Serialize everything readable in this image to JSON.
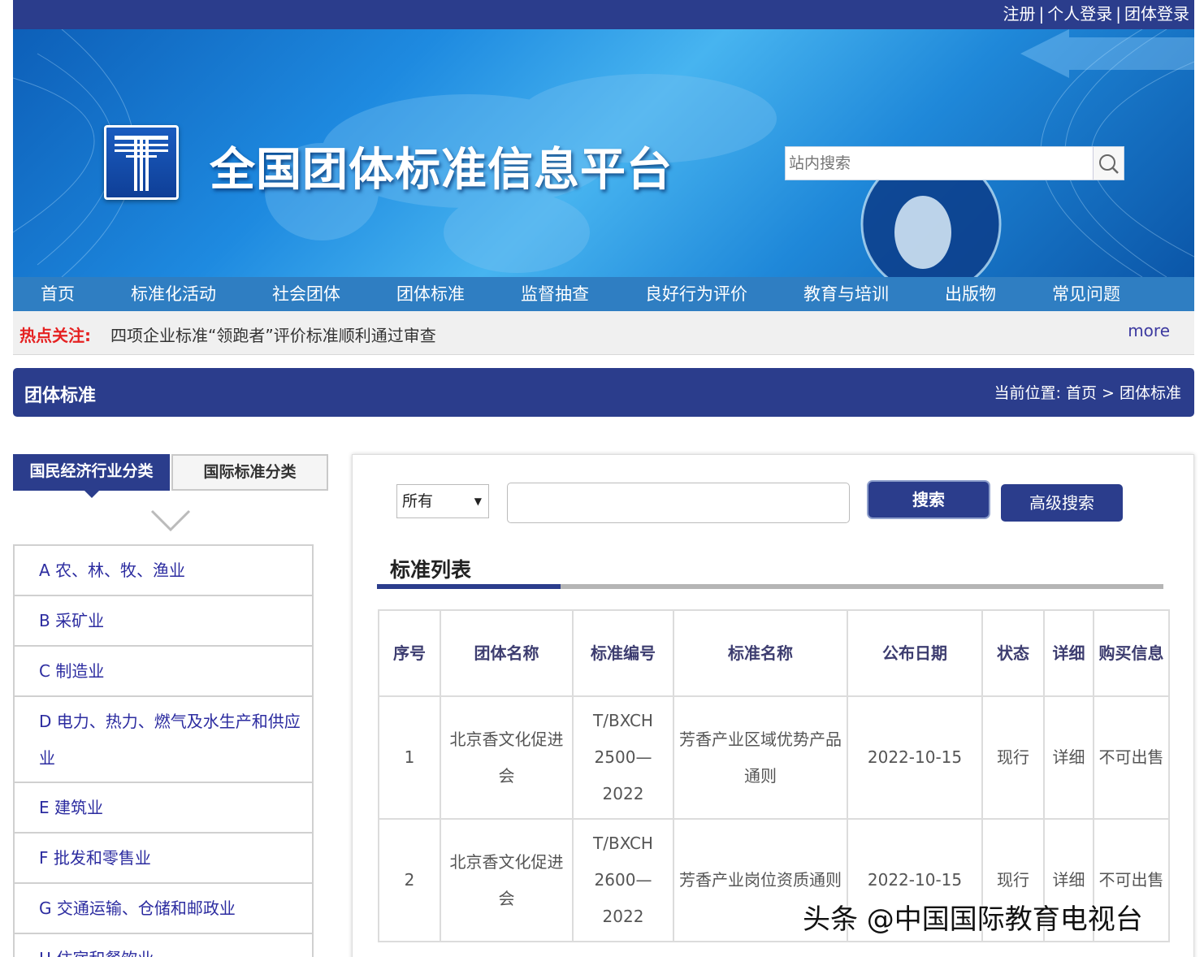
{
  "top_links": {
    "register": "注册",
    "personal_login": "个人登录",
    "group_login": "团体登录",
    "separator": "|"
  },
  "site": {
    "title": "全国团体标准信息平台",
    "search_placeholder": "站内搜索"
  },
  "nav": [
    "首页",
    "标准化活动",
    "社会团体",
    "团体标准",
    "监督抽查",
    "良好行为评价",
    "教育与培训",
    "出版物",
    "常见问题"
  ],
  "hot": {
    "label": "热点关注:",
    "text": "四项企业标准“领跑者”评价标准顺利通过审查",
    "more": "more"
  },
  "section": {
    "title": "团体标准",
    "breadcrumb": "当前位置: 首页 > 团体标准"
  },
  "category_tabs": {
    "active": "国民经济行业分类",
    "inactive": "国际标准分类"
  },
  "categories": [
    "A 农、林、牧、渔业",
    "B 采矿业",
    "C 制造业",
    "D 电力、热力、燃气及水生产和供应业",
    "E 建筑业",
    "F 批发和零售业",
    "G 交通运输、仓储和邮政业",
    "H 住宿和餐饮业"
  ],
  "search": {
    "select_value": "所有",
    "search_button": "搜索",
    "advanced_button": "高级搜索"
  },
  "list_title": "标准列表",
  "table": {
    "headers": [
      "序号",
      "团体名称",
      "标准编号",
      "标准名称",
      "公布日期",
      "状态",
      "详细",
      "购买信息"
    ],
    "rows": [
      [
        "1",
        "北京香文化促进会",
        "T/BXCH 2500—2022",
        "芳香产业区域优势产品通则",
        "2022-10-15",
        "现行",
        "详细",
        "不可出售"
      ],
      [
        "2",
        "北京香文化促进会",
        "T/BXCH 2600—2022",
        "芳香产业岗位资质通则",
        "2022-10-15",
        "现行",
        "详细",
        "不可出售"
      ]
    ]
  },
  "watermark": "头条 @中国国际教育电视台",
  "colors": {
    "primary": "#2b3d8c",
    "nav": "#2f7ec2",
    "hot_label": "#e52222",
    "link": "#2c2ca0"
  }
}
